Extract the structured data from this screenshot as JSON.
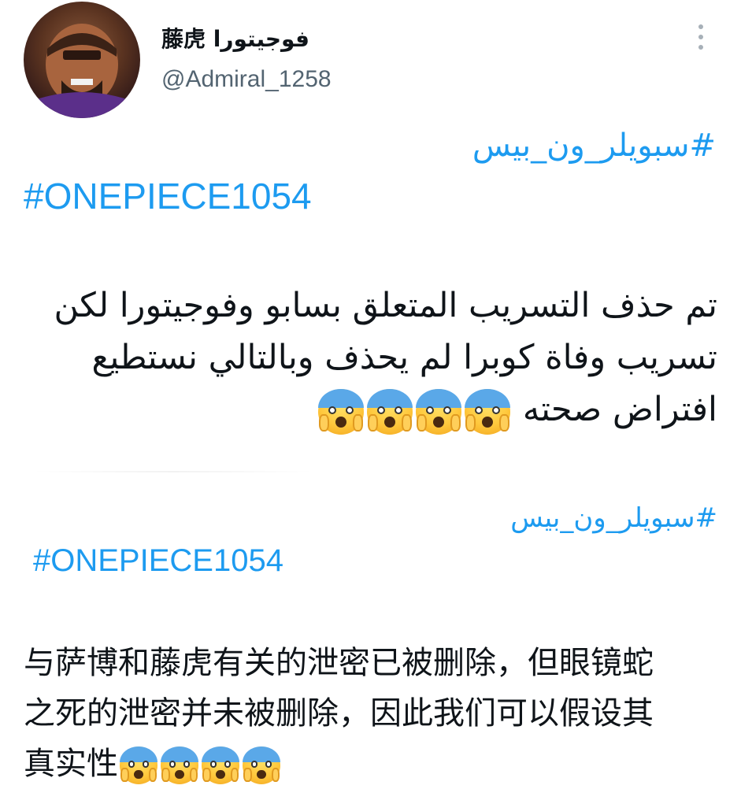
{
  "tweet": {
    "author": {
      "display_name": "藤虎 فوجيتورا",
      "handle": "@Admiral_1258"
    },
    "icons": {
      "more": "more-vertical-icon",
      "emoji": "face-screaming-in-fear-icon"
    },
    "colors": {
      "hashtag": "#1d9bf0",
      "text": "#0f1419",
      "handle": "#536471"
    },
    "arabic_section": {
      "hashtag_ar": "#سبويلر_ون_بيس",
      "hashtag_en": "#ONEPIECE1054",
      "lines": [
        "تم حذف التسريب المتعلق بسابو وفوجيتورا لكن",
        "تسريب وفاة كوبرا لم يحذف وبالتالي نستطيع",
        "افتراض صحته"
      ]
    },
    "chinese_section": {
      "hashtag_ar": "#سبويلر_ون_بيس",
      "hashtag_en": "#ONEPIECE1054",
      "lines": [
        "与萨博和藤虎有关的泄密已被删除，但眼镜蛇",
        "之死的泄密并未被删除，因此我们可以假设其",
        "真实性"
      ]
    }
  }
}
